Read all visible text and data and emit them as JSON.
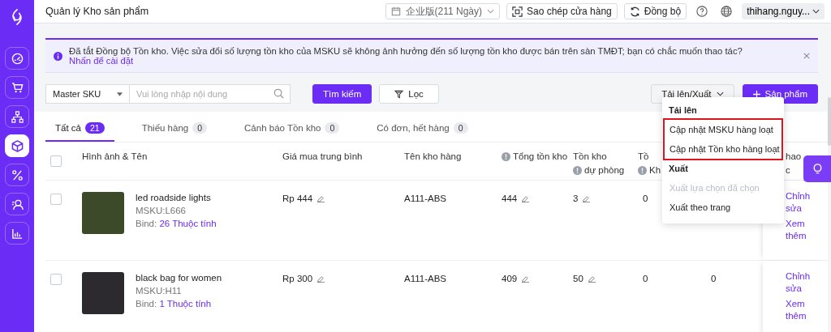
{
  "sidebar": {
    "items": [
      {
        "kind": "gauge",
        "selected": false
      },
      {
        "kind": "cart",
        "selected": false
      },
      {
        "kind": "hierarchy",
        "selected": false
      },
      {
        "kind": "box",
        "selected": true
      },
      {
        "kind": "percent",
        "selected": false
      },
      {
        "kind": "user-search",
        "selected": false
      },
      {
        "kind": "chart",
        "selected": false
      }
    ]
  },
  "topbar": {
    "title": "Quản lý Kho sản phẩm",
    "plan": "企业版(211 Ngày)",
    "copy_store": "Sao chép cửa hàng",
    "sync": "Đồng bộ",
    "user": "thihang.nguy..."
  },
  "alert": {
    "text": "Đã tắt Đồng bộ Tồn kho. Việc sửa đổi số lượng tồn kho của MSKU sẽ không ảnh hưởng đến số lượng tồn kho được bán trên sàn TMĐT; bạn có chắc muốn thao tác?",
    "link": "Nhấn để cài đặt"
  },
  "search": {
    "field_select": "Master SKU",
    "placeholder": "Vui lòng nhập nội dung",
    "search_button": "Tìm kiếm",
    "filter_button": "Lọc",
    "upload_export": "Tải lên/Xuất",
    "add_product": "Sản phẩm"
  },
  "tabs": [
    {
      "label": "Tất cả",
      "count": "21",
      "selected": true
    },
    {
      "label": "Thiếu hàng",
      "count": "0",
      "selected": false
    },
    {
      "label": "Cảnh báo Tồn kho",
      "count": "0",
      "selected": false
    },
    {
      "label": "Có đơn, hết hàng",
      "count": "0",
      "selected": false
    }
  ],
  "table": {
    "select_all_checked": false,
    "columns": [
      {
        "lines": [
          {
            "text": "Hình ảnh & Tên",
            "info": false
          }
        ]
      },
      {
        "lines": [
          {
            "text": "Giá mua trung bình",
            "info": false
          }
        ]
      },
      {
        "lines": [
          {
            "text": "Tên kho hàng",
            "info": false
          }
        ]
      },
      {
        "lines": [
          {
            "text": "Tổng tồn kho",
            "info": true
          }
        ]
      },
      {
        "lines": [
          {
            "text": "Tồn kho",
            "info": false
          },
          {
            "text": "dự phòng",
            "info": true
          }
        ]
      },
      {
        "lines": [
          {
            "text": "Tồ",
            "info": false
          },
          {
            "text": "Kh",
            "info": true
          }
        ]
      },
      {},
      {
        "lines": [
          {
            "text": "hao",
            "info": false
          },
          {
            "text": "c",
            "info": false
          }
        ]
      }
    ],
    "rows": [
      {
        "checked": false,
        "name": "led roadside lights",
        "msku": "MSKU:L666",
        "bind_label": "Bind:",
        "bind_link": "26 Thuộc tính",
        "price": "Rp 444",
        "warehouse": "A111-ABS",
        "total": "444",
        "reserve": "3",
        "column_6": "0",
        "actions": [
          "Chỉnh sửa",
          "Xem thêm"
        ]
      },
      {
        "checked": false,
        "name": "black bag for women",
        "msku": "MSKU:H11",
        "bind_label": "Bind:",
        "bind_link": "1 Thuộc tính",
        "price": "Rp 300",
        "warehouse": "A111-ABS",
        "total": "409",
        "reserve": "50",
        "column_6": "0",
        "column_7": "0",
        "actions": [
          "Chỉnh sửa",
          "Xem thêm"
        ]
      }
    ]
  },
  "menu": {
    "groups": [
      {
        "title": "Tải lên",
        "highlighted": true,
        "items": [
          {
            "label": "Cập nhật MSKU hàng loạt",
            "disabled": false
          },
          {
            "label": "Cập nhật Tồn kho hàng loạt",
            "disabled": false
          }
        ]
      },
      {
        "title": "Xuất",
        "highlighted": false,
        "items": [
          {
            "label": "Xuất lựa chọn đã chọn",
            "disabled": true
          },
          {
            "label": "Xuất theo trang",
            "disabled": false
          }
        ]
      }
    ]
  }
}
